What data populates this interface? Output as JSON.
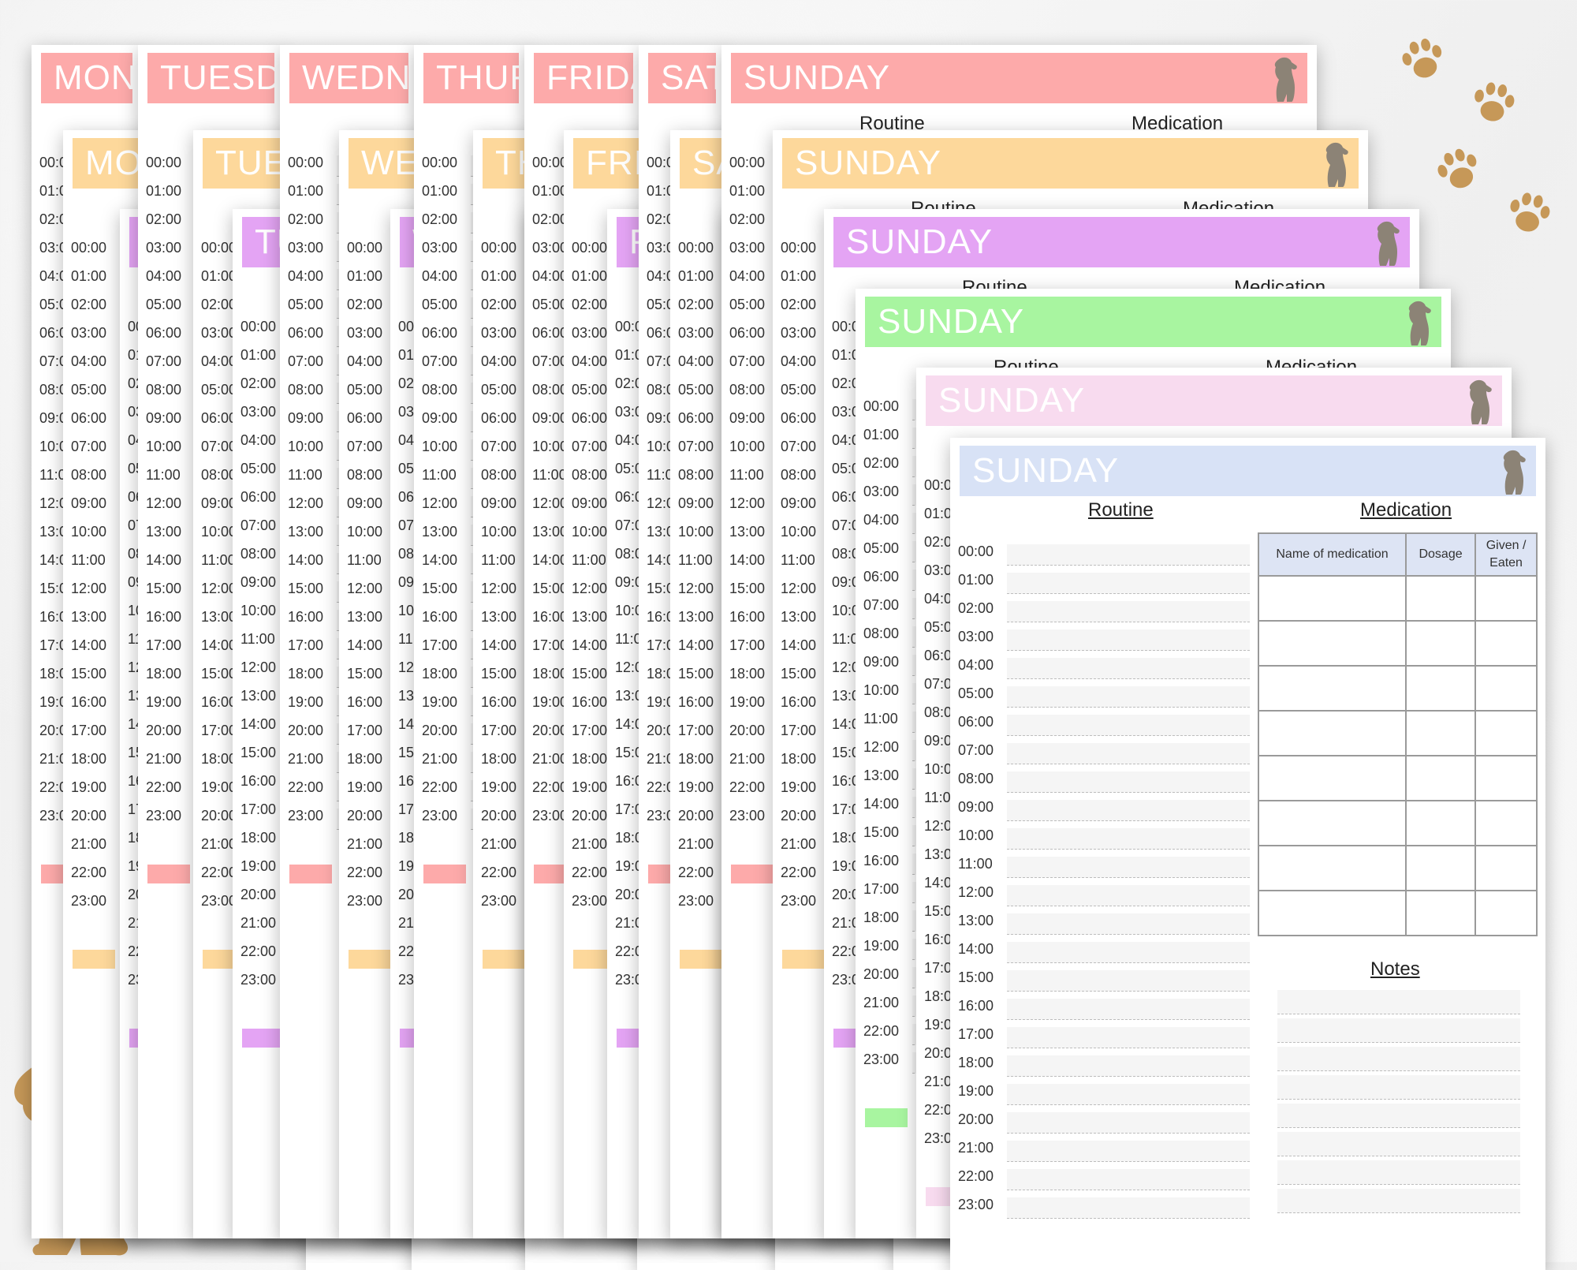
{
  "days": [
    "MONDAY",
    "TUESDAY",
    "WEDNESDAY",
    "THURSDAY",
    "FRIDAY",
    "SATURDAY",
    "SUNDAY"
  ],
  "times": [
    "00:00",
    "01:00",
    "02:00",
    "03:00",
    "04:00",
    "05:00",
    "06:00",
    "07:00",
    "08:00",
    "09:00",
    "10:00",
    "11:00",
    "12:00",
    "13:00",
    "14:00",
    "15:00",
    "16:00",
    "17:00",
    "18:00",
    "19:00",
    "20:00",
    "21:00",
    "22:00",
    "23:00"
  ],
  "sections": {
    "routine": "Routine",
    "medication": "Medication",
    "notes": "Notes"
  },
  "medication_table": {
    "headers": [
      "Name of medication",
      "Dosage",
      "Given / Eaten"
    ],
    "row_count": 8
  },
  "colors": {
    "red": "#fdaaaa",
    "orange": "#fdd89b",
    "purple": "#e4a4f4",
    "green": "#a8f5a0",
    "pink": "#f8dbef",
    "blue": "#d8e2f6",
    "dog": "#c69858",
    "dog_icon": "#8c8376"
  },
  "icons": [
    "dog-silhouette-icon",
    "paw-print-icon",
    "dog-head-icon"
  ]
}
